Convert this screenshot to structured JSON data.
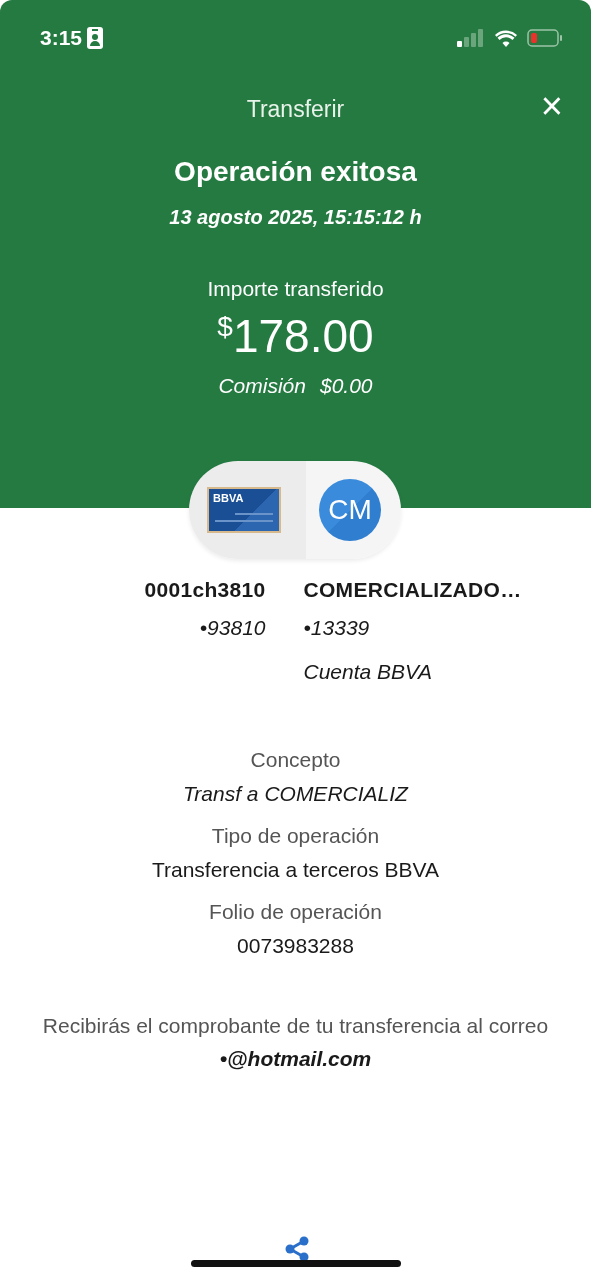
{
  "status_bar": {
    "time": "3:15"
  },
  "header": {
    "title": "Transferir",
    "close": "×"
  },
  "result": {
    "heading": "Operación exitosa",
    "date": "13 agosto 2025, 15:15:12 h",
    "amount_label": "Importe transferido",
    "currency": "$",
    "amount": "178.00",
    "fee_label": "Comisión",
    "fee": "$0.00"
  },
  "transfer": {
    "card_label": "BBVA",
    "recipient_initials": "CM"
  },
  "origin": {
    "name": "0001ch3810",
    "account": "•93810"
  },
  "destination": {
    "name": "COMERCIALIZADO…",
    "account": "•13339",
    "bank": "Cuenta BBVA"
  },
  "details": [
    {
      "label": "Concepto",
      "value": "Transf a COMERCIALIZ",
      "italic": true
    },
    {
      "label": "Tipo de operación",
      "value": "Transferencia a terceros BBVA",
      "italic": false
    },
    {
      "label": "Folio de operación",
      "value": "0073983288",
      "italic": false
    }
  ],
  "notice": {
    "text": "Recibirás el comprobante de tu transferencia al correo",
    "email": "•@hotmail.com"
  }
}
